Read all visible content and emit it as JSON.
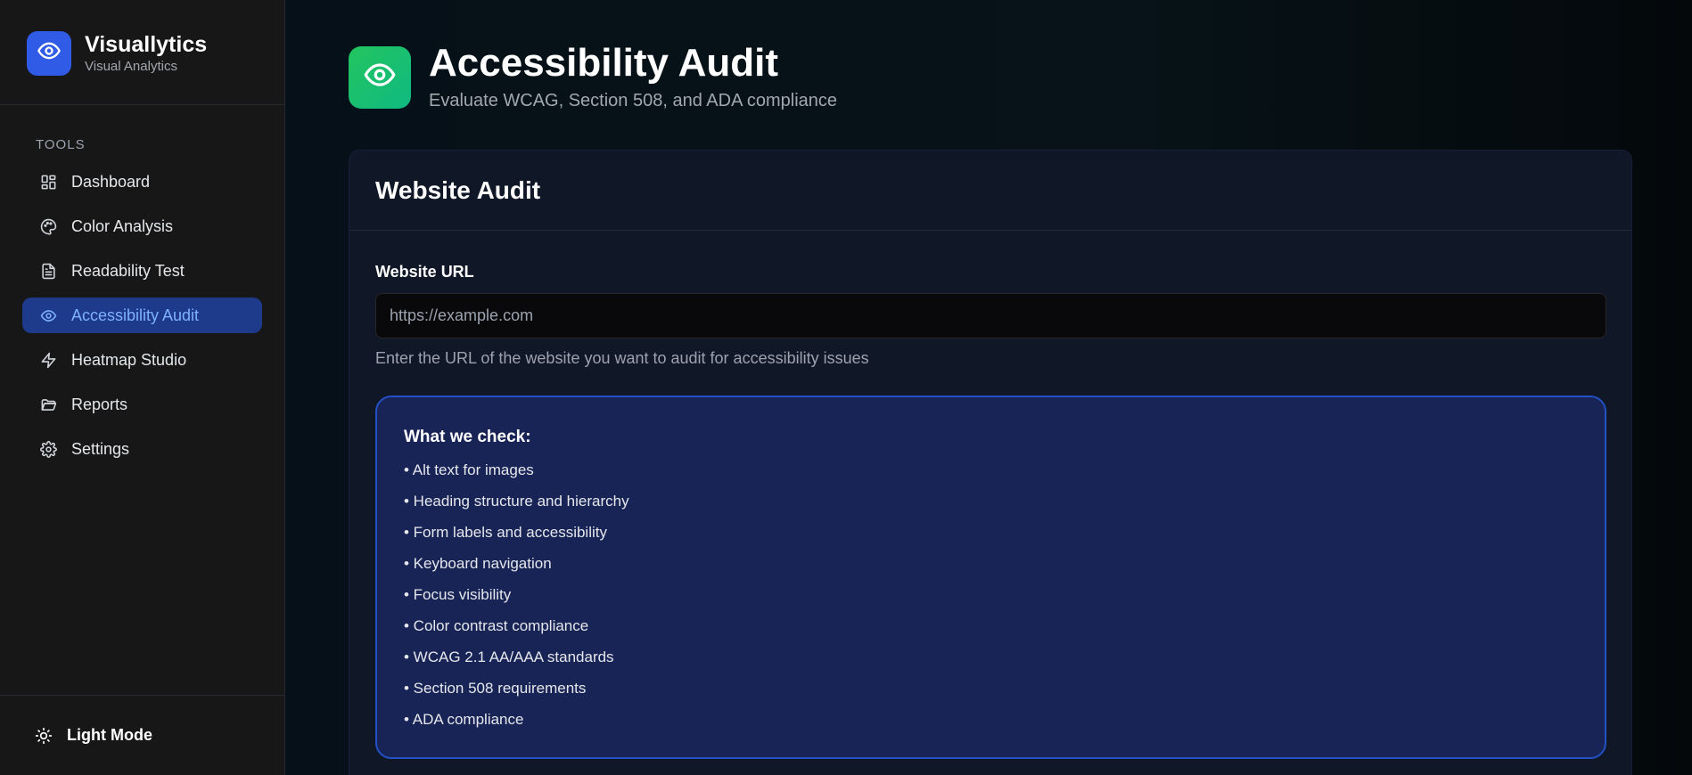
{
  "brand": {
    "name": "Visuallytics",
    "subtitle": "Visual Analytics",
    "logo_icon": "eye-icon",
    "color": "#2f5be6"
  },
  "sidebar": {
    "section_label": "TOOLS",
    "items": [
      {
        "label": "Dashboard",
        "icon": "grid-icon",
        "active": false
      },
      {
        "label": "Color Analysis",
        "icon": "palette-icon",
        "active": false
      },
      {
        "label": "Readability Test",
        "icon": "document-icon",
        "active": false
      },
      {
        "label": "Accessibility Audit",
        "icon": "eye-icon",
        "active": true
      },
      {
        "label": "Heatmap Studio",
        "icon": "lightning-icon",
        "active": false
      },
      {
        "label": "Reports",
        "icon": "folder-icon",
        "active": false
      },
      {
        "label": "Settings",
        "icon": "gear-icon",
        "active": false
      }
    ],
    "footer": {
      "label": "Light Mode",
      "icon": "sun-icon"
    }
  },
  "header": {
    "title": "Accessibility Audit",
    "subtitle": "Evaluate WCAG, Section 508, and ADA compliance",
    "icon": "eye-icon",
    "icon_color": "#22c55e"
  },
  "card": {
    "title": "Website Audit",
    "url_label": "Website URL",
    "url_value": "",
    "url_placeholder": "https://example.com",
    "help_text": "Enter the URL of the website you want to audit for accessibility issues",
    "checks": {
      "title": "What we check:",
      "items": [
        "• Alt text for images",
        "• Heading structure and hierarchy",
        "• Form labels and accessibility",
        "• Keyboard navigation",
        "• Focus visibility",
        "• Color contrast compliance",
        "• WCAG 2.1 AA/AAA standards",
        "• Section 508 requirements",
        "• ADA compliance"
      ]
    }
  },
  "colors": {
    "active_nav_bg": "#1e3a8a",
    "active_nav_text": "#7fb0ff",
    "check_box_bg": "#182456",
    "check_box_border": "#2450c5"
  }
}
